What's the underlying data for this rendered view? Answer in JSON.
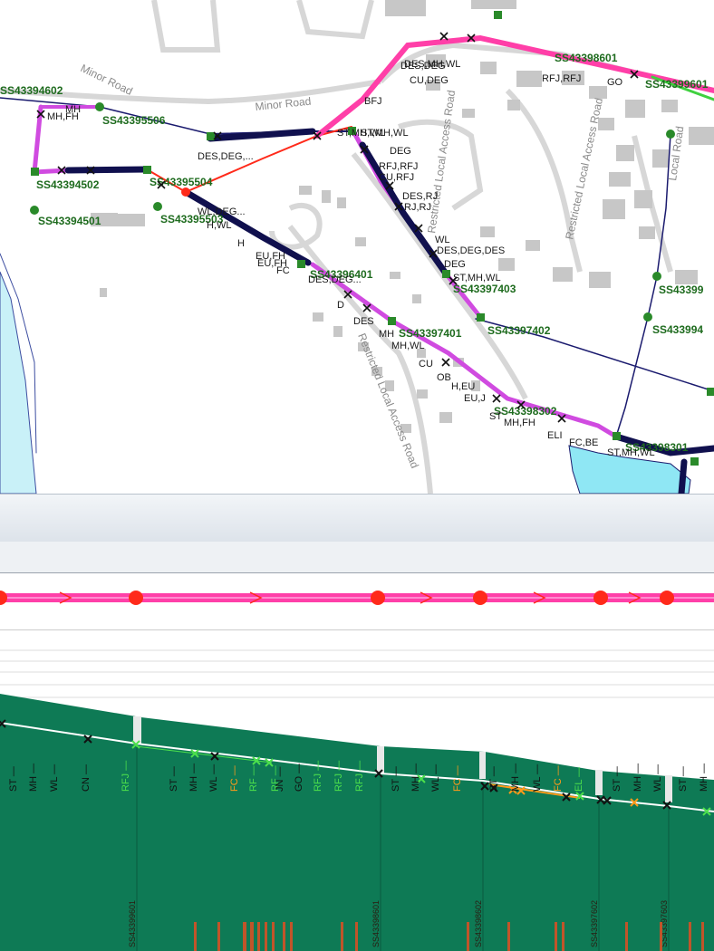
{
  "map": {
    "roads": [
      {
        "label": "Minor Road"
      },
      {
        "label": "Minor Road"
      },
      {
        "label": "Restricted Local Access Road"
      },
      {
        "label": "Restricted Local Access Road"
      },
      {
        "label": "Restricted Local Access Road"
      },
      {
        "label": "Local Road"
      }
    ],
    "nodes": [
      {
        "id": "SS43394602"
      },
      {
        "id": "SS43395506"
      },
      {
        "id": "SS43394502"
      },
      {
        "id": "SS43394501"
      },
      {
        "id": "SS43395504"
      },
      {
        "id": "SS43395503"
      },
      {
        "id": "SS43396401"
      },
      {
        "id": "SS43397403"
      },
      {
        "id": "SS43397401"
      },
      {
        "id": "SS43397402"
      },
      {
        "id": "SS43398302"
      },
      {
        "id": "SS43398301"
      },
      {
        "id": "SS43398601"
      },
      {
        "id": "SS43399601"
      },
      {
        "id": "SS43399"
      },
      {
        "id": "SS433994"
      }
    ],
    "observations": [
      "MH,FH",
      "MH",
      "DES,DEG,...",
      "ST,MH,WL",
      "DEG",
      "RFJ,RFJ",
      "CU,RFJ",
      "DES,RJ",
      "RJ,RJ",
      "WL",
      "DES,DEG,DES",
      "DEG",
      "ST,MH,WL",
      "ST,MH,WL",
      "H",
      "WL,DEG...",
      "H,WL",
      "EU,FH",
      "EU,FH",
      "FC",
      "DES,DEG...",
      "D",
      "DES",
      "MH",
      "MH,WL",
      "CU",
      "OB",
      "H,EU",
      "EU,J",
      "ST",
      "MH,FH",
      "ELI",
      "FC,BE",
      "ST,MH,WL",
      "DES,DEG",
      "CU,DEG",
      "BFJ",
      "DES,MH,WL",
      "GO",
      "RFJ,RFJ"
    ]
  },
  "profile": {
    "node_labels": [
      "SS43399601",
      "SS43398601",
      "SS43398602",
      "SS43397602",
      "SS43397603"
    ],
    "groups": [
      {
        "labels": [
          "ST",
          "MH",
          "WL",
          "CN"
        ],
        "colors": [
          "k",
          "k",
          "k",
          "k"
        ]
      },
      {
        "labels": [
          "RFJ"
        ],
        "colors": [
          "g"
        ]
      },
      {
        "labels": [
          "ST",
          "MH",
          "WL",
          "FC",
          "RF",
          "RF",
          "JN",
          "GO",
          "RFJ",
          "RFJ",
          "RFJ"
        ],
        "colors": [
          "k",
          "k",
          "k",
          "o",
          "g",
          "g",
          "k",
          "k",
          "g",
          "g",
          "g"
        ]
      },
      {
        "labels": [
          "ST",
          "MH",
          "WL",
          "FC"
        ],
        "colors": [
          "k",
          "k",
          "k",
          "o"
        ]
      },
      {
        "labels": [
          "ST",
          "MH",
          "WL",
          "FC",
          "EL"
        ],
        "colors": [
          "k",
          "k",
          "k",
          "o",
          "g"
        ]
      },
      {
        "labels": [
          "ST",
          "MH",
          "WL"
        ],
        "colors": [
          "k",
          "k",
          "k"
        ]
      },
      {
        "labels": [
          "ST",
          "MH"
        ],
        "colors": [
          "k",
          "k"
        ]
      }
    ]
  },
  "colors": {
    "ground": "#0e7a55",
    "pipe_pink": "#ff3fa8",
    "pipe_red": "#ff2a1a",
    "pipe_magenta": "#d04be0",
    "pipe_navy": "#1a1a6e",
    "node_green": "#2a8a2a",
    "water": "#8fe7f4"
  }
}
